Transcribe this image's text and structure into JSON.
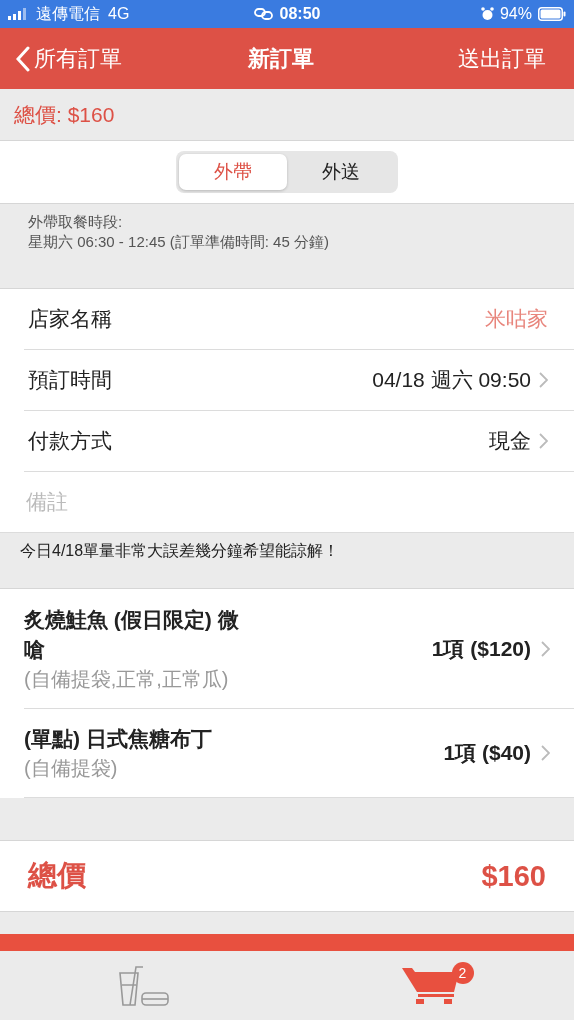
{
  "status_bar": {
    "carrier": "遠傳電信",
    "network": "4G",
    "time": "08:50",
    "battery": "94%"
  },
  "nav": {
    "back": "所有訂單",
    "title": "新訂單",
    "action": "送出訂單"
  },
  "summary": "總價: $160",
  "modes": [
    {
      "label": "外帶",
      "selected": true
    },
    {
      "label": "外送",
      "selected": false
    }
  ],
  "pickup_info": [
    "外帶取餐時段:",
    "星期六 06:30 - 12:45 (訂單準備時間: 45 分鐘)"
  ],
  "fields": [
    {
      "kind": "info",
      "label": "店家名稱",
      "value": "米咕家"
    },
    {
      "kind": "picker",
      "label": "預訂時間",
      "value": "04/18 週六 09:50"
    },
    {
      "kind": "picker",
      "label": "付款方式",
      "value": "現金"
    }
  ],
  "remark": {
    "placeholder": "備註"
  },
  "notice": "今日4/18單量非常大誤差幾分鐘希望能諒解！",
  "items": [
    {
      "name": "炙燒鮭魚 (假日限定) 微嗆",
      "options": "(自備提袋,正常,正常瓜)",
      "quantity": "1項 ($120)"
    },
    {
      "name": "(單點) 日式焦糖布丁",
      "options": "(自備提袋)",
      "quantity": "1項 ($40)"
    }
  ],
  "total": {
    "label": "總價",
    "amount": "$160"
  },
  "tab_bar": [
    {
      "kind": "menu",
      "selected": false
    },
    {
      "kind": "cart",
      "selected": true,
      "badge": "2"
    }
  ]
}
